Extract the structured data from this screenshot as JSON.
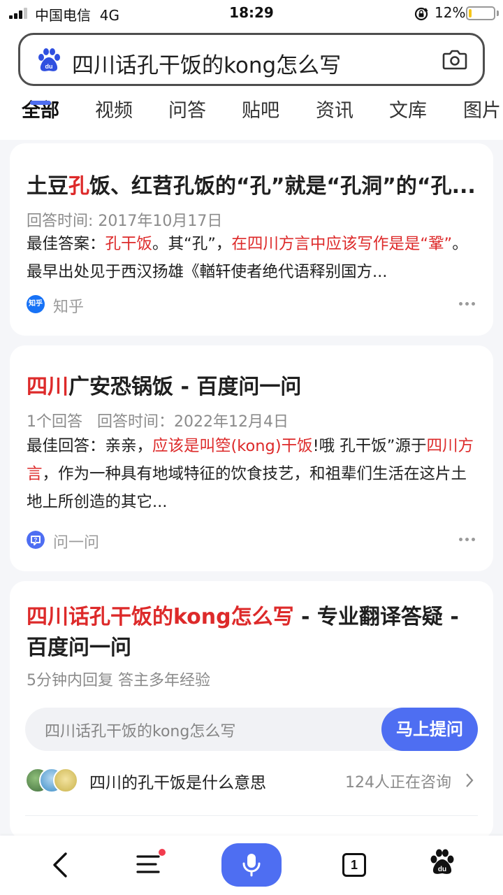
{
  "status_bar": {
    "carrier": "中国电信",
    "network": "4G",
    "time": "18:29",
    "battery_percent": "12%",
    "battery_level": 0.12,
    "icons": [
      "signal-icon",
      "rotation-lock-icon",
      "battery-icon"
    ]
  },
  "search": {
    "query": "四川话孔干饭的kong怎么写",
    "icons": [
      "baidu-logo-icon",
      "camera-icon"
    ]
  },
  "tabs": [
    {
      "label": "全部",
      "active": true
    },
    {
      "label": "视频",
      "active": false
    },
    {
      "label": "问答",
      "active": false
    },
    {
      "label": "贴吧",
      "active": false
    },
    {
      "label": "资讯",
      "active": false
    },
    {
      "label": "文库",
      "active": false
    },
    {
      "label": "图片",
      "active": false
    }
  ],
  "results": [
    {
      "title_parts": [
        "土豆",
        "孔",
        "饭、红苕孔饭的“孔”就是“孔洞”的“孔..."
      ],
      "meta": "回答时间: 2017年10月17日",
      "abstract_parts": [
        "最佳答案：",
        "孔干饭",
        "。其“孔”，",
        "在四川方言中应该写作是是“鞏”",
        "。最早出处见于西汉扬雄《輶轩使者绝代语释别国方..."
      ],
      "source": "知乎",
      "source_icon_text": "知乎"
    },
    {
      "title_parts": [
        "四川",
        "广安恐锅饭 - 百度问一问"
      ],
      "meta": "1个回答   回答时间：2022年12月4日",
      "abstract_parts": [
        "最佳回答：亲亲，",
        "应该是叫箜(kong)干饭",
        "!哦 孔干饭”源于",
        "四川方言",
        "，作为一种具有地域特征的饮食技艺，和祖辈们生活在这片土地上所创造的其它..."
      ],
      "source": "问一问"
    },
    {
      "title_parts": [
        "四川话孔干饭的kong怎么写",
        " - 专业翻译答疑 - 百度问一问"
      ],
      "meta": "5分钟内回复 答主多年经验",
      "ask_placeholder": "四川话孔干饭的kong怎么写",
      "ask_button": "马上提问",
      "related_question": "四川的孔干饭是什么意思",
      "consult_count": "124人正在咨询"
    }
  ],
  "bottom_nav": {
    "pages_count": "1",
    "icons": [
      "back-icon",
      "menu-icon",
      "microphone-icon",
      "pages-icon",
      "baidu-home-icon"
    ]
  },
  "colors": {
    "accent": "#4e6ef2",
    "highlight": "#dd2a2a",
    "notification_dot": "#f23c4e"
  }
}
